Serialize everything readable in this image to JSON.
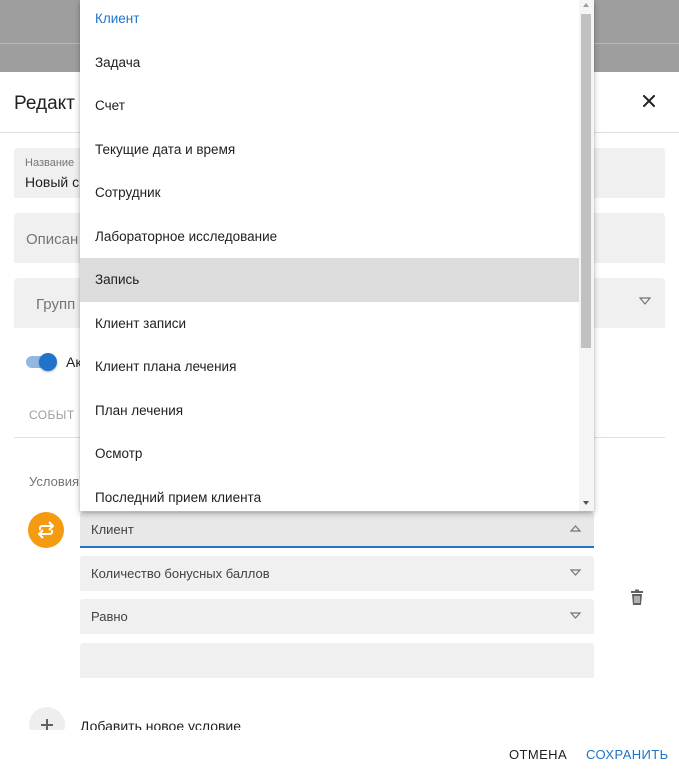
{
  "dialog": {
    "title": "Редакт",
    "name_field": {
      "label": "Название",
      "value": "Новый сц"
    },
    "description_field": {
      "placeholder": "Описан"
    },
    "group_field": {
      "placeholder": "Групп"
    },
    "toggle_label": "Ак",
    "tab_label": "СОБЫТ",
    "conditions_label": "Условия",
    "condition": {
      "entity_value": "Клиент",
      "field_value": "Количество бонусных баллов",
      "operator_value": "Равно",
      "value": ""
    },
    "add_condition_label": "Добавить новое условие",
    "footer": {
      "cancel_label": "ОТМЕНА",
      "save_label": "СОХРАНИТЬ"
    }
  },
  "dropdown": {
    "selected": "Клиент",
    "hovered": "Запись",
    "options": [
      "Клиент",
      "Задача",
      "Счет",
      "Текущие дата и время",
      "Сотрудник",
      "Лабораторное исследование",
      "Запись",
      "Клиент записи",
      "Клиент плана лечения",
      "План лечения",
      "Осмотр",
      "Последний прием клиента"
    ]
  },
  "colors": {
    "accent": "#1f73c9",
    "condition_icon": "#f59b0f",
    "field_background": "#f0f0f0",
    "hover_background": "#dcdcdc"
  },
  "icons": {
    "close": "close-icon",
    "condition": "swap-icon",
    "delete": "trash-icon",
    "add": "plus-icon",
    "select_arrow": "triangle-down-icon"
  }
}
